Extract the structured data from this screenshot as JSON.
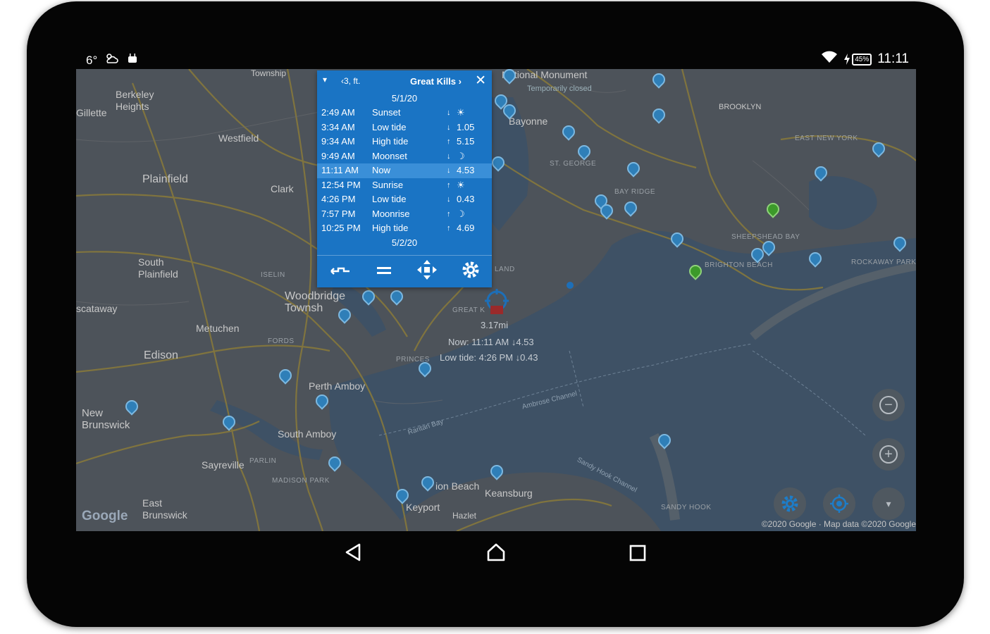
{
  "status_bar": {
    "temperature": "6°",
    "weather_icon": "cloud-sun-icon",
    "android_icon": "android-icon",
    "wifi_icon": "wifi-icon",
    "battery_icon": "battery-charging-icon",
    "battery": "45%",
    "time": "11:11"
  },
  "tide_panel": {
    "menu_glyph": "▾",
    "height_label": "‹3, ft.",
    "station": "Great Kills ›",
    "close_glyph": "✕",
    "date1": "5/1/20",
    "date2": "5/2/20",
    "rows": [
      {
        "time": "2:49 AM",
        "event": "Sunset",
        "arrow": "↓",
        "value": "☀"
      },
      {
        "time": "3:34 AM",
        "event": "Low tide",
        "arrow": "↓",
        "value": "1.05"
      },
      {
        "time": "9:34 AM",
        "event": "High tide",
        "arrow": "↑",
        "value": "5.15"
      },
      {
        "time": "9:49 AM",
        "event": "Moonset",
        "arrow": "↓",
        "value": "☽"
      },
      {
        "time": "11:11 AM",
        "event": "Now",
        "arrow": "↓",
        "value": "4.53"
      },
      {
        "time": "12:54 PM",
        "event": "Sunrise",
        "arrow": "↑",
        "value": "☀"
      },
      {
        "time": "4:26 PM",
        "event": "Low tide",
        "arrow": "↓",
        "value": "0.43"
      },
      {
        "time": "7:57 PM",
        "event": "Moonrise",
        "arrow": "↑",
        "value": "☽"
      },
      {
        "time": "10:25 PM",
        "event": "High tide",
        "arrow": "↑",
        "value": "4.69"
      }
    ],
    "toolbar_icons": [
      "swap-icon",
      "equals-icon",
      "move-icon",
      "settings-icon"
    ]
  },
  "map": {
    "labels": [
      {
        "text": "Berkeley\nHeights"
      },
      {
        "text": "Gillette"
      },
      {
        "text": "Westfield"
      },
      {
        "text": "Plainfield"
      },
      {
        "text": "Clark"
      },
      {
        "text": "South\nPlainfield"
      },
      {
        "text": "Woodbridge\nTownship"
      },
      {
        "text": "scataway"
      },
      {
        "text": "Metuchen"
      },
      {
        "text": "Edison"
      },
      {
        "text": "Perth Amboy"
      },
      {
        "text": "New\nBrunswick"
      },
      {
        "text": "South Amboy"
      },
      {
        "text": "Sayreville"
      },
      {
        "text": "East\nBrunswick"
      },
      {
        "text": "Keyport"
      },
      {
        "text": "Hazlet"
      },
      {
        "text": "Keansburg"
      },
      {
        "text": "ion Beach"
      },
      {
        "text": "BROOKLYN"
      },
      {
        "text": "Bayonne"
      },
      {
        "text": "National Monument"
      },
      {
        "text": "Township"
      },
      {
        "text": "Temporarily closed"
      }
    ],
    "small_labels": [
      "EAST NEW YORK",
      "ST. GEORGE",
      "BAY RIDGE",
      "SHEEPSHEAD BAY",
      "BRIGHTON BEACH",
      "ROCKAWAY PARK",
      "SANDY HOOK",
      "GREAT K",
      "PRINCES",
      "FORDS",
      "ISELIN",
      "MADISON PARK",
      "PARLIN",
      "LAND"
    ],
    "water_labels": [
      "Raritan Bay",
      "Ambrose Channel",
      "Sandy Hook Channel"
    ],
    "distance": "3.17mi",
    "now_info": "Now: 11:11 AM ↓4.53",
    "next_info": "Low tide: 4:26 PM ↓0.43",
    "google_logo": "Google",
    "copyright": "©2020 Google · Map data ©2020 Google"
  },
  "map_controls": {
    "zoom_out": "−",
    "zoom_in": "+",
    "settings": "settings-icon",
    "locate": "my-location-icon",
    "expand": "▾"
  },
  "nav_bar": {
    "back": "back-icon",
    "home": "home-icon",
    "recents": "recents-icon"
  }
}
